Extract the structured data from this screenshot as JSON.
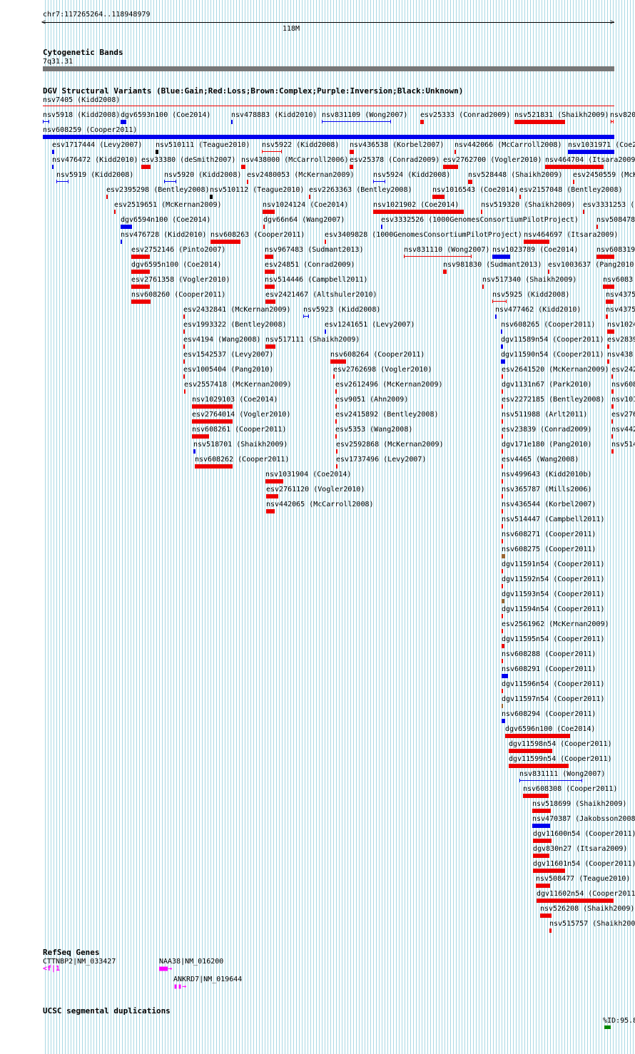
{
  "ruler": {
    "position": "chr7:117265264..118948979",
    "center_label": "118M"
  },
  "cytoband": {
    "title": "Cytogenetic Bands",
    "band": "7q31.31"
  },
  "dgv": {
    "title": "DGV Structural Variants (Blue:Gain;Red:Loss;Brown:Complex;Purple:Inversion;Black:Unknown)",
    "top_label": "nsv7405 (Kidd2008)"
  },
  "colors": {
    "gain": "#0000ee",
    "loss": "#ee0000",
    "complex": "#996633",
    "unknown": "#000000",
    "gene": "#ff00ff",
    "segdup": "#008800"
  },
  "variants": [
    {
      "label": "nsv5918 (Kidd2008)",
      "type": "gain"
    },
    {
      "label": "dgv6593n100 (Coe2014)",
      "type": "gain"
    },
    {
      "label": "nsv478883 (Kidd2010)",
      "type": "gain"
    },
    {
      "label": "nsv831109 (Wong2007)",
      "type": "gain"
    },
    {
      "label": "esv25333 (Conrad2009)",
      "type": "loss"
    },
    {
      "label": "nsv521831 (Shaikh2009)",
      "type": "loss"
    },
    {
      "label": "nsv820",
      "type": "loss"
    },
    {
      "label": "nsv608259 (Cooper2011)",
      "type": "gain"
    },
    {
      "label": "esv1717444 (Levy2007)",
      "type": "gain"
    },
    {
      "label": "nsv510111 (Teague2010)",
      "type": "unknown"
    },
    {
      "label": "nsv5922 (Kidd2008)",
      "type": "loss"
    },
    {
      "label": "nsv436538 (Korbel2007)",
      "type": "loss"
    },
    {
      "label": "nsv442066 (McCarroll2008)",
      "type": "loss"
    },
    {
      "label": "nsv1031971 (Coe2",
      "type": "gain"
    },
    {
      "label": "nsv476472 (Kidd2010)",
      "type": "gain"
    },
    {
      "label": "esv33380 (deSmith2007)",
      "type": "loss"
    },
    {
      "label": "nsv438000 (McCarroll2006)",
      "type": "loss"
    },
    {
      "label": "esv25378 (Conrad2009)",
      "type": "loss"
    },
    {
      "label": "esv2762700 (Vogler2010)",
      "type": "loss"
    },
    {
      "label": "nsv464704 (Itsara2009",
      "type": "loss"
    },
    {
      "label": "nsv5919 (Kidd2008)",
      "type": "gain"
    },
    {
      "label": "nsv5920 (Kidd2008)",
      "type": "gain"
    },
    {
      "label": "esv2480053 (McKernan2009)",
      "type": "loss"
    },
    {
      "label": "nsv5924 (Kidd2008)",
      "type": "gain"
    },
    {
      "label": "nsv528448 (Shaikh2009)",
      "type": "loss"
    },
    {
      "label": "esv2450559 (McK",
      "type": "loss"
    },
    {
      "label": "esv2395298 (Bentley2008)",
      "type": "loss"
    },
    {
      "label": "nsv510112 (Teague2010)",
      "type": "unknown"
    },
    {
      "label": "esv2263363 (Bentley2008)",
      "type": "loss"
    },
    {
      "label": "nsv1016543 (Coe2014)",
      "type": "loss"
    },
    {
      "label": "esv2157048 (Bentley2008)",
      "type": "loss"
    },
    {
      "label": "esv2519651 (McKernan2009)",
      "type": "loss"
    },
    {
      "label": "nsv1024124 (Coe2014)",
      "type": "loss"
    },
    {
      "label": "nsv1021902 (Coe2014)",
      "type": "loss"
    },
    {
      "label": "nsv519320 (Shaikh2009)",
      "type": "loss"
    },
    {
      "label": "esv3331253 (",
      "type": "loss"
    },
    {
      "label": "dgv6594n100 (Coe2014)",
      "type": "gain"
    },
    {
      "label": "dgv66n64 (Wang2007)",
      "type": "loss"
    },
    {
      "label": "esv3332526 (1000GenomesConsortiumPilotProject)",
      "type": "gain"
    },
    {
      "label": "nsv508478",
      "type": "loss"
    },
    {
      "label": "nsv476728 (Kidd2010)",
      "type": "gain"
    },
    {
      "label": "nsv608263 (Cooper2011)",
      "type": "loss"
    },
    {
      "label": "esv3409828 (1000GenomesConsortiumPilotProject)",
      "type": "loss"
    },
    {
      "label": "nsv464697 (Itsara2009)",
      "type": "loss"
    },
    {
      "label": "esv2752146 (Pinto2007)",
      "type": "loss"
    },
    {
      "label": "nsv967483 (Sudmant2013)",
      "type": "loss"
    },
    {
      "label": "nsv831110 (Wong2007)",
      "type": "loss"
    },
    {
      "label": "nsv1023789 (Coe2014)",
      "type": "gain"
    },
    {
      "label": "nsv608319",
      "type": "loss"
    },
    {
      "label": "dgv6595n100 (Coe2014)",
      "type": "loss"
    },
    {
      "label": "esv24851 (Conrad2009)",
      "type": "loss"
    },
    {
      "label": "nsv981830 (Sudmant2013)",
      "type": "loss"
    },
    {
      "label": "esv1003637 (Pang2010",
      "type": "loss"
    },
    {
      "label": "esv2761358 (Vogler2010)",
      "type": "loss"
    },
    {
      "label": "nsv514446 (Campbell2011)",
      "type": "loss"
    },
    {
      "label": "nsv517340 (Shaikh2009)",
      "type": "loss"
    },
    {
      "label": "nsv6083",
      "type": "loss"
    },
    {
      "label": "nsv608260 (Cooper2011)",
      "type": "loss"
    },
    {
      "label": "esv2421467 (Altshuler2010)",
      "type": "loss"
    },
    {
      "label": "nsv5925 (Kidd2008)",
      "type": "loss"
    },
    {
      "label": "nsv4375",
      "type": "loss"
    },
    {
      "label": "esv2432841 (McKernan2009)",
      "type": "loss"
    },
    {
      "label": "nsv5923 (Kidd2008)",
      "type": "gain"
    },
    {
      "label": "nsv477462 (Kidd2010)",
      "type": "gain"
    },
    {
      "label": "nsv4375",
      "type": "loss"
    },
    {
      "label": "esv1993322 (Bentley2008)",
      "type": "loss"
    },
    {
      "label": "esv1241651 (Levy2007)",
      "type": "gain"
    },
    {
      "label": "nsv608265 (Cooper2011)",
      "type": "gain"
    },
    {
      "label": "nsv1024",
      "type": "loss"
    },
    {
      "label": "esv4194 (Wang2008)",
      "type": "loss"
    },
    {
      "label": "nsv517111 (Shaikh2009)",
      "type": "loss"
    },
    {
      "label": "dgv11589n54 (Cooper2011)",
      "type": "gain"
    },
    {
      "label": "esv2839",
      "type": "loss"
    },
    {
      "label": "esv1542537 (Levy2007)",
      "type": "loss"
    },
    {
      "label": "nsv608264 (Cooper2011)",
      "type": "loss"
    },
    {
      "label": "dgv11590n54 (Cooper2011)",
      "type": "gain"
    },
    {
      "label": "nsv438",
      "type": "loss"
    },
    {
      "label": "esv1005404 (Pang2010)",
      "type": "loss"
    },
    {
      "label": "esv2762698 (Vogler2010)",
      "type": "loss"
    },
    {
      "label": "esv2641520 (McKernan2009)",
      "type": "loss"
    },
    {
      "label": "esv242",
      "type": "loss"
    },
    {
      "label": "esv2557418 (McKernan2009)",
      "type": "loss"
    },
    {
      "label": "esv2612496 (McKernan2009)",
      "type": "loss"
    },
    {
      "label": "dgv1131n67 (Park2010)",
      "type": "loss"
    },
    {
      "label": "nsv608",
      "type": "loss"
    },
    {
      "label": "nsv1029103 (Coe2014)",
      "type": "loss"
    },
    {
      "label": "esv9051 (Ahn2009)",
      "type": "loss"
    },
    {
      "label": "esv2272185 (Bentley2008)",
      "type": "loss"
    },
    {
      "label": "nsv101",
      "type": "loss"
    },
    {
      "label": "esv2764014 (Vogler2010)",
      "type": "loss"
    },
    {
      "label": "esv2415892 (Bentley2008)",
      "type": "loss"
    },
    {
      "label": "nsv511988 (Arlt2011)",
      "type": "loss"
    },
    {
      "label": "esv276",
      "type": "loss"
    },
    {
      "label": "nsv608261 (Cooper2011)",
      "type": "loss"
    },
    {
      "label": "esv5353 (Wang2008)",
      "type": "loss"
    },
    {
      "label": "esv23839 (Conrad2009)",
      "type": "loss"
    },
    {
      "label": "nsv442",
      "type": "loss"
    },
    {
      "label": "nsv518701 (Shaikh2009)",
      "type": "gain"
    },
    {
      "label": "esv2592868 (McKernan2009)",
      "type": "loss"
    },
    {
      "label": "dgv171e180 (Pang2010)",
      "type": "loss"
    },
    {
      "label": "nsv514",
      "type": "loss"
    },
    {
      "label": "nsv608262 (Cooper2011)",
      "type": "loss"
    },
    {
      "label": "esv1737496 (Levy2007)",
      "type": "loss"
    },
    {
      "label": "esv4465 (Wang2008)",
      "type": "loss"
    },
    {
      "label": "nsv1031904 (Coe2014)",
      "type": "loss"
    },
    {
      "label": "nsv499643 (Kidd2010b)",
      "type": "loss"
    },
    {
      "label": "esv2761120 (Vogler2010)",
      "type": "loss"
    },
    {
      "label": "nsv365787 (Mills2006)",
      "type": "loss"
    },
    {
      "label": "nsv442065 (McCarroll2008)",
      "type": "loss"
    },
    {
      "label": "nsv436544 (Korbel2007)",
      "type": "loss"
    },
    {
      "label": "nsv514447 (Campbell2011)",
      "type": "loss"
    },
    {
      "label": "nsv608271 (Cooper2011)",
      "type": "loss"
    },
    {
      "label": "nsv608275 (Cooper2011)",
      "type": "complex"
    },
    {
      "label": "dgv11591n54 (Cooper2011)",
      "type": "loss"
    },
    {
      "label": "dgv11592n54 (Cooper2011)",
      "type": "loss"
    },
    {
      "label": "dgv11593n54 (Cooper2011)",
      "type": "complex"
    },
    {
      "label": "dgv11594n54 (Cooper2011)",
      "type": "loss"
    },
    {
      "label": "esv2561962 (McKernan2009)",
      "type": "loss"
    },
    {
      "label": "dgv11595n54 (Cooper2011)",
      "type": "loss"
    },
    {
      "label": "nsv608288 (Cooper2011)",
      "type": "loss"
    },
    {
      "label": "nsv608291 (Cooper2011)",
      "type": "gain"
    },
    {
      "label": "dgv11596n54 (Cooper2011)",
      "type": "loss"
    },
    {
      "label": "dgv11597n54 (Cooper2011)",
      "type": "complex"
    },
    {
      "label": "nsv608294 (Cooper2011)",
      "type": "gain"
    },
    {
      "label": "dgv6596n100 (Coe2014)",
      "type": "loss"
    },
    {
      "label": "dgv11598n54 (Cooper2011)",
      "type": "loss"
    },
    {
      "label": "dgv11599n54 (Cooper2011)",
      "type": "loss"
    },
    {
      "label": "nsv831111 (Wong2007)",
      "type": "gain"
    },
    {
      "label": "nsv608308 (Cooper2011)",
      "type": "loss"
    },
    {
      "label": "nsv518699 (Shaikh2009)",
      "type": "loss"
    },
    {
      "label": "nsv470387 (Jakobsson2008",
      "type": "gain"
    },
    {
      "label": "dgv11600n54 (Cooper2011)",
      "type": "loss"
    },
    {
      "label": "dgv830n27 (Itsara2009)",
      "type": "loss"
    },
    {
      "label": "dgv11601n54 (Cooper2011)",
      "type": "loss"
    },
    {
      "label": "nsv508477 (Teague2010)",
      "type": "loss"
    },
    {
      "label": "dgv11602n54 (Cooper2011",
      "type": "loss"
    },
    {
      "label": "nsv526208 (Shaikh2009)",
      "type": "loss"
    },
    {
      "label": "nsv515757 (Shaikh200",
      "type": "loss"
    }
  ],
  "refseq": {
    "title": "RefSeq Genes",
    "genes": [
      "CTTNBP2|NM_033427",
      "NAA38|NM_016200",
      "ANKRD7|NM_019644"
    ]
  },
  "segdup": {
    "title": "UCSC segmental duplications",
    "label": "%ID:95.8"
  }
}
